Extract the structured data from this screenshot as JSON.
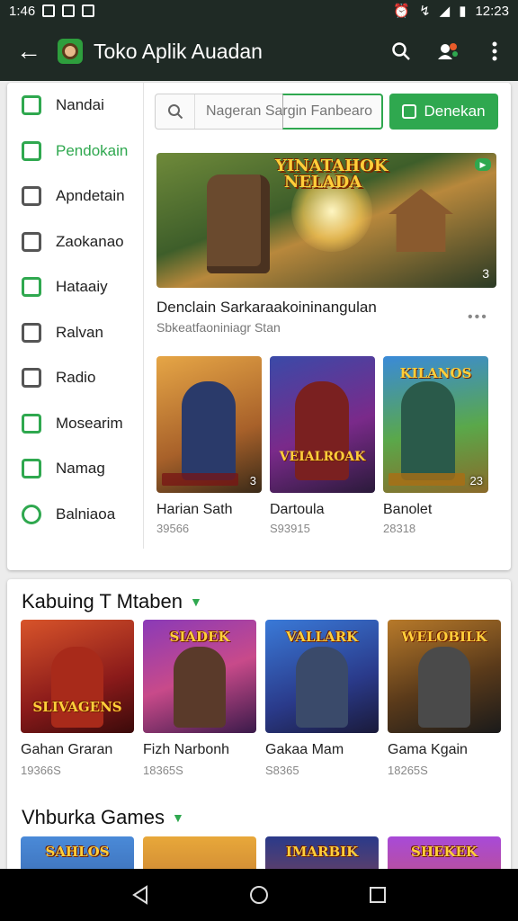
{
  "status_bar": {
    "time_left": "1:46",
    "time_right": "12:23"
  },
  "app_bar": {
    "title": "Toko Aplik Auadan"
  },
  "sidebar": {
    "items": [
      {
        "label": "Nandai",
        "icon": "home-icon"
      },
      {
        "label": "Pendokain",
        "icon": "edit-icon",
        "active": true
      },
      {
        "label": "Apndetain",
        "icon": "square-icon"
      },
      {
        "label": "Zaokanao",
        "icon": "chart-icon"
      },
      {
        "label": "Hataaiy",
        "icon": "tag-icon"
      },
      {
        "label": "Ralvan",
        "icon": "grid-icon"
      },
      {
        "label": "Radio",
        "icon": "radio-icon"
      },
      {
        "label": "Mosearim",
        "icon": "store-icon"
      },
      {
        "label": "Namag",
        "icon": "note-icon"
      },
      {
        "label": "Balniaoa",
        "icon": "clock-icon"
      }
    ]
  },
  "search": {
    "placeholder": "Nageran Sargin Fanbearo"
  },
  "download_button": {
    "label": "Denekan"
  },
  "featured": {
    "logo_text": "YINATAHOK NELADA",
    "badge": "3",
    "title": "Denclain Sarkaraakoininangulan",
    "subtitle": "Sbkeatfaoniniagr Stan"
  },
  "mini_apps": [
    {
      "name": "Harian Sath",
      "count": "39566",
      "thumb_text": "",
      "badge": "3"
    },
    {
      "name": "Dartoula",
      "count": "S93915",
      "thumb_text": "VEIALROAK",
      "badge": ""
    },
    {
      "name": "Banolet",
      "count": "28318",
      "thumb_text": "KILANOS",
      "badge": "23"
    }
  ],
  "section1": {
    "heading": "Kabuing T Mtaben",
    "games": [
      {
        "name": "Gahan Graran",
        "count": "19366S",
        "thumb_text": "SLIVAGENS"
      },
      {
        "name": "Fizh Narbonh",
        "count": "18365S",
        "thumb_text": "SIADEK"
      },
      {
        "name": "Gakaa Mam",
        "count": "S8365",
        "thumb_text": "VALLARK"
      },
      {
        "name": "Gama Kgain",
        "count": "18265S",
        "thumb_text": "WELOBILK"
      }
    ]
  },
  "section2": {
    "heading": "Vhburka Games",
    "games": [
      {
        "thumb_text": "SAHLOS"
      },
      {
        "thumb_text": ""
      },
      {
        "thumb_text": "IMARBIK"
      },
      {
        "thumb_text": "SHEKEK"
      }
    ]
  },
  "colors": {
    "accent": "#2fa84f",
    "appbar": "#1f2a25"
  }
}
